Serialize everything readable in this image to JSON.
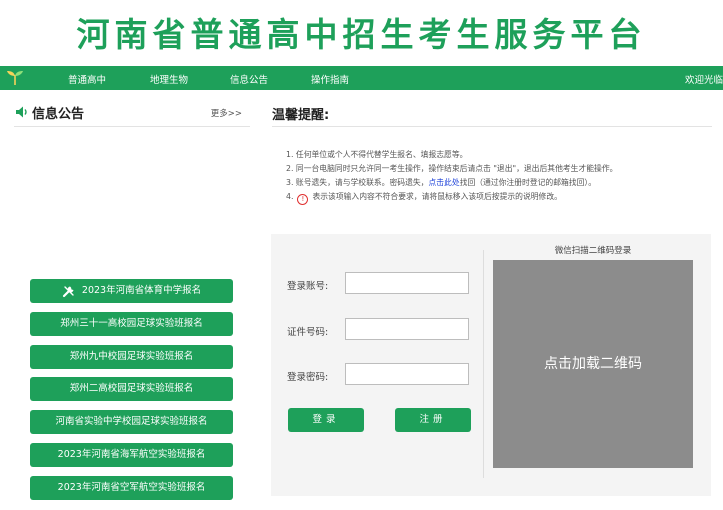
{
  "header": {
    "title": "河南省普通高中招生考生服务平台"
  },
  "nav": {
    "items": [
      "普通高中",
      "地理生物",
      "信息公告",
      "操作指南"
    ],
    "welcome": "欢迎光临"
  },
  "notice": {
    "title": "信息公告",
    "more": "更多>>"
  },
  "registrations": [
    "2023年河南省体育中学报名",
    "郑州三十一高校园足球实验班报名",
    "郑州九中校园足球实验班报名",
    "郑州二高校园足球实验班报名",
    "河南省实验中学校园足球实验班报名",
    "2023年河南省海军航空实验班报名",
    "2023年河南省空军航空实验班报名"
  ],
  "tips": {
    "title": "温馨提醒:",
    "line1": "1. 任何单位或个人不得代替学生报名、填报志愿等。",
    "line2": "2. 同一台电脑同时只允许同一考生操作，操作结束后请点击 \"退出\"，退出后其他考生才能操作。",
    "line3_a": "3. 账号遗失，请与学校联系。密码遗失，",
    "line3_link": "点击此处",
    "line3_b": "找回（通过你注册时登记的邮箱找回）。",
    "line4_a": "4.",
    "line4_mark": "!",
    "line4_b": "表示该项输入内容不符合要求，请将鼠标移入该项后按提示的说明修改。"
  },
  "login": {
    "account_label": "登录账号:",
    "id_label": "证件号码:",
    "password_label": "登录密码:",
    "login_button": "登录",
    "register_button": "注册"
  },
  "qr": {
    "title": "微信扫描二维码登录",
    "placeholder": "点击加载二维码"
  },
  "colors": {
    "brand": "#1ea05a",
    "link": "#1a3fd8",
    "warn": "#e03030",
    "qr_bg": "#8c8c8c"
  }
}
